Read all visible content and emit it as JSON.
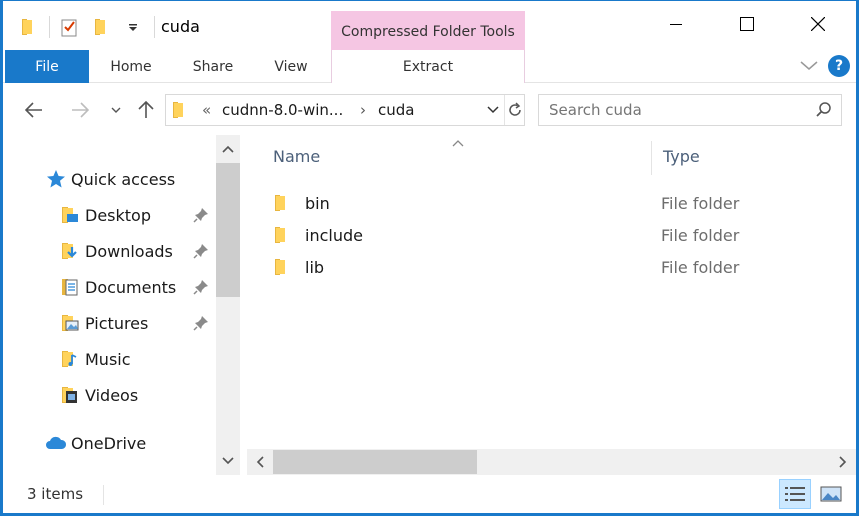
{
  "window": {
    "title": "cuda",
    "context_group": "Compressed Folder Tools"
  },
  "ribbon": {
    "tabs": [
      {
        "label": "File"
      },
      {
        "label": "Home"
      },
      {
        "label": "Share"
      },
      {
        "label": "View"
      },
      {
        "label": "Extract"
      }
    ]
  },
  "address": {
    "overflow": "«",
    "crumbs": [
      "cudnn-8.0-win...",
      "cuda"
    ],
    "separator": "›"
  },
  "search": {
    "placeholder": "Search cuda"
  },
  "nav": {
    "items": [
      {
        "label": "Quick access",
        "icon": "star-icon"
      },
      {
        "label": "Desktop",
        "icon": "desktop-folder-icon",
        "pinned": true
      },
      {
        "label": "Downloads",
        "icon": "downloads-folder-icon",
        "pinned": true
      },
      {
        "label": "Documents",
        "icon": "documents-folder-icon",
        "pinned": true
      },
      {
        "label": "Pictures",
        "icon": "pictures-folder-icon",
        "pinned": true
      },
      {
        "label": "Music",
        "icon": "music-folder-icon",
        "pinned": false
      },
      {
        "label": "Videos",
        "icon": "videos-folder-icon",
        "pinned": false
      },
      {
        "label": "OneDrive",
        "icon": "cloud-icon"
      }
    ]
  },
  "columns": {
    "name": "Name",
    "type": "Type"
  },
  "files": [
    {
      "name": "bin",
      "type": "File folder"
    },
    {
      "name": "include",
      "type": "File folder"
    },
    {
      "name": "lib",
      "type": "File folder"
    }
  ],
  "status": {
    "count": "3 items"
  },
  "colors": {
    "accent": "#1979ca",
    "context_tab": "#f5c6e3",
    "folder": "#ffd35c"
  }
}
